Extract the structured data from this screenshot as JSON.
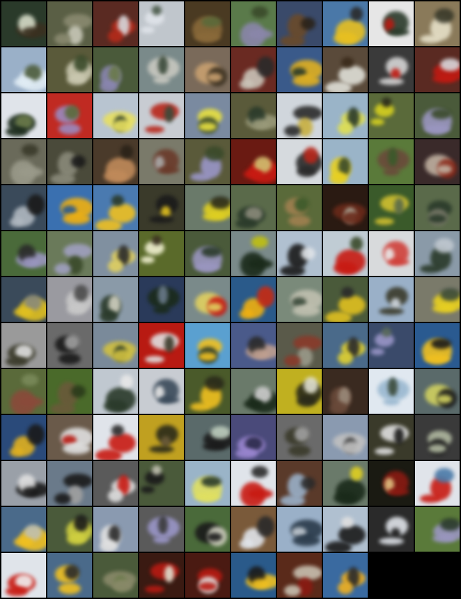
{
  "grid": {
    "rows": 13,
    "cols": 10,
    "tile_count": 128,
    "background": "#000000",
    "tiles": [
      [
        "#2a3a2a",
        "#3a3020",
        "#d6dcc8"
      ],
      [
        "#5a5f45",
        "#8a8a70",
        "#c8c8b8"
      ],
      [
        "#5a2a22",
        "#b52a1a",
        "#d6d8dc"
      ],
      [
        "#c0c6cc",
        "#e0e4ea",
        "#4a5a4a"
      ],
      [
        "#4a3a22",
        "#8a6a3a",
        "#5a6a3a"
      ],
      [
        "#5a7a4a",
        "#8a86aa",
        "#3a4a2a"
      ],
      [
        "#3a4a6a",
        "#6a4a2a",
        "#2a2218"
      ],
      [
        "#4a78a8",
        "#e8c020",
        "#2a2a2a"
      ],
      [
        "#e6e6e6",
        "#2a3a2a",
        "#b81a12"
      ],
      [
        "#8a7a5a",
        "#e6e0c8",
        "#3a3a2a"
      ],
      [
        "#9ab0c8",
        "#e0ecf4",
        "#4a5a3a"
      ],
      [
        "#5a5a3a",
        "#cac8b0",
        "#3a4a2a"
      ],
      [
        "#4a5a3a",
        "#8a86b0",
        "#6a7a4a"
      ],
      [
        "#7a8a8a",
        "#c8c8c0",
        "#3a4a3a"
      ],
      [
        "#7a6a5a",
        "#c8a070",
        "#3a3020"
      ],
      [
        "#6a2a22",
        "#cac4b8",
        "#2a2a2a"
      ],
      [
        "#3a5a8a",
        "#e0b020",
        "#2a3a2a"
      ],
      [
        "#5a4a3a",
        "#e0e0d8",
        "#3a2a1a"
      ],
      [
        "#3a3a3a",
        "#d6d6d6",
        "#c01a12"
      ],
      [
        "#5a2a22",
        "#c01a12",
        "#d6d8dc"
      ],
      [
        "#e0e4ea",
        "#1a2a1a",
        "#6a7a4a"
      ],
      [
        "#c02a22",
        "#9a8ac0",
        "#5a6a3a"
      ],
      [
        "#b8c4d0",
        "#e8e060",
        "#2a3a2a"
      ],
      [
        "#c8ccd2",
        "#b8261a",
        "#3a4a3a"
      ],
      [
        "#7a8aa0",
        "#e8e040",
        "#3a4a2a"
      ],
      [
        "#5a5a3a",
        "#9a9a7a",
        "#2a3a2a"
      ],
      [
        "#d0d6dc",
        "#2a2a2a",
        "#c8b040"
      ],
      [
        "#9ab4c8",
        "#e0e050",
        "#2a3a2a"
      ],
      [
        "#5a6a3a",
        "#d6d020",
        "#2a2a1a"
      ],
      [
        "#4a5a3a",
        "#9a96c0",
        "#3a4a2a"
      ],
      [
        "#6a6a5a",
        "#9a9a8a",
        "#3a3a2a"
      ],
      [
        "#4a4a3a",
        "#8a8a7a",
        "#1a1a1a"
      ],
      [
        "#4a3a2a",
        "#c08a5a",
        "#2a2218"
      ],
      [
        "#7a7a6a",
        "#6a3a2a",
        "#aaa"
      ],
      [
        "#5a5a3a",
        "#9a96c8",
        "#3a4a2a"
      ],
      [
        "#6a1a12",
        "#c81a12",
        "#d0c070"
      ],
      [
        "#d6dade",
        "#2a2a2a",
        "#b8261a"
      ],
      [
        "#9ab4c8",
        "#e8d020",
        "#3a4a2a"
      ],
      [
        "#5a7a3a",
        "#6a4a3a",
        "#3a5a2a"
      ],
      [
        "#3a2a2a",
        "#c0b0a0",
        "#8a2a1a"
      ],
      [
        "#3a4a5a",
        "#b0b8c0",
        "#1a1a1a"
      ],
      [
        "#3a70b0",
        "#f0b010",
        "#2a5a90"
      ],
      [
        "#4a7ab0",
        "#f0c020",
        "#2a3a2a"
      ],
      [
        "#3a3a2a",
        "#1a1a1a",
        "#e0c020"
      ],
      [
        "#6a7a6a",
        "#e0d020",
        "#2a2a1a"
      ],
      [
        "#5a6a4a",
        "#2a3a2a",
        "#8a8a7a"
      ],
      [
        "#5a6a3a",
        "#a08050",
        "#3a5a2a"
      ],
      [
        "#2a1a12",
        "#6a2a1a",
        "#b0b0a0"
      ],
      [
        "#3a5a2a",
        "#d0c030",
        "#5a6a4a"
      ],
      [
        "#5a6a4a",
        "#2a3a2a",
        "#7a7a6a"
      ],
      [
        "#4a6a3a",
        "#9a96c0",
        "#2a2a2a"
      ],
      [
        "#6a7a5a",
        "#a0a0c0",
        "#3a4a2a"
      ],
      [
        "#8090a0",
        "#e0d060",
        "#2a2a2a"
      ],
      [
        "#5a6a2a",
        "#f0f0d0",
        "#3a3020"
      ],
      [
        "#4a5a3a",
        "#9a96c0",
        "#2a3a2a"
      ],
      [
        "#7a8a8a",
        "#1a2a1a",
        "#c0c010"
      ],
      [
        "#b0c0d0",
        "#1a1a1a",
        "#e0e4e8"
      ],
      [
        "#c0ccd4",
        "#c81a12",
        "#3a4a2a"
      ],
      [
        "#d8dadc",
        "#d0403a",
        "#eaeaea"
      ],
      [
        "#8a9aa8",
        "#2a3a2a",
        "#c0c8d0"
      ],
      [
        "#3a4a5a",
        "#e0c020",
        "#8a8a7a"
      ],
      [
        "#9a9aa0",
        "#c8c8c8",
        "#4a4a4a"
      ],
      [
        "#8a9aa8",
        "#2a3a2a",
        "#d0d0c0"
      ],
      [
        "#2a3a5a",
        "#1a2a1a",
        "#6a7a8a"
      ],
      [
        "#7a8a8a",
        "#e0d060",
        "#c81a12"
      ],
      [
        "#2a5a8a",
        "#f0b010",
        "#c82a12"
      ],
      [
        "#7a8a7a",
        "#c0c0b0",
        "#3a4a3a"
      ],
      [
        "#4a5a3a",
        "#e0c020",
        "#2a2a2a"
      ],
      [
        "#9ab0c8",
        "#3a3a2a",
        "#d0d8e0"
      ],
      [
        "#7a7a6a",
        "#e8d020",
        "#3a4a3a"
      ],
      [
        "#9a9a9a",
        "#3a3a2a",
        "#e0e0e0"
      ],
      [
        "#6a6a6a",
        "#1a1a1a",
        "#a0a0a0"
      ],
      [
        "#7a8a9a",
        "#d0c040",
        "#2a3a2a"
      ],
      [
        "#b81a12",
        "#e0e0e0",
        "#3a3a2a"
      ],
      [
        "#5aa0d0",
        "#f0c020",
        "#2a3a2a"
      ],
      [
        "#4a5a8a",
        "#c0a090",
        "#2a2a2a"
      ],
      [
        "#5a5a4a",
        "#8a3a2a",
        "#9a9a8a"
      ],
      [
        "#4a6a8a",
        "#e0d030",
        "#2a2a2a"
      ],
      [
        "#3a4a6a",
        "#9a96c8",
        "#5a6a5a"
      ],
      [
        "#2a5a90",
        "#f0c020",
        "#1a1a1a"
      ],
      [
        "#5a6a3a",
        "#8a4a3a",
        "#7a8a5a"
      ],
      [
        "#4a6a2a",
        "#6a5a3a",
        "#2a3a1a"
      ],
      [
        "#c0c8d0",
        "#2a3a2a",
        "#e8e8e8"
      ],
      [
        "#c8ccd2",
        "#3a4a5a",
        "#e6e6e6"
      ],
      [
        "#4a5a2a",
        "#f0c020",
        "#2a2a1a"
      ],
      [
        "#6a7a6a",
        "#1a2a1a",
        "#d0d0d0"
      ],
      [
        "#c0b020",
        "#2a2a1a",
        "#e0e0d0"
      ],
      [
        "#3a2a20",
        "#6a4a3a",
        "#9a8a7a"
      ],
      [
        "#e0e8f0",
        "#9ab8d0",
        "#3a4a3a"
      ],
      [
        "#5a6a6a",
        "#d0d060",
        "#1a1a1a"
      ],
      [
        "#2a4a7a",
        "#e0b020",
        "#1a1a1a"
      ],
      [
        "#6a5a4a",
        "#e0e0e0",
        "#b81a12"
      ],
      [
        "#e0e4ea",
        "#c81a12",
        "#2a2a2a"
      ],
      [
        "#c0a020",
        "#2a2a1a",
        "#6a5a3a"
      ],
      [
        "#5a6a6a",
        "#1a1a1a",
        "#c0d0c0"
      ],
      [
        "#4a4a7a",
        "#9a86d0",
        "#2a2a4a"
      ],
      [
        "#6a6a6a",
        "#3a3a2a",
        "#a0a0a0"
      ],
      [
        "#8a9ab0",
        "#c0c0c0",
        "#3a3a3a"
      ],
      [
        "#3a3a2a",
        "#e0e0e0",
        "#1a1a1a"
      ],
      [
        "#3a3a3a",
        "#b0b8a0",
        "#1a1a1a"
      ],
      [
        "#9aa0a8",
        "#1a1a1a",
        "#e0e0e0"
      ],
      [
        "#6a7a8a",
        "#1a1a1a",
        "#a0a0a0"
      ],
      [
        "#5a5a5a",
        "#e0e0e0",
        "#c81a12"
      ],
      [
        "#4a5a3a",
        "#1a1a1a",
        "#c0c0b0"
      ],
      [
        "#9ab4c8",
        "#e0e060",
        "#2a3a2a"
      ],
      [
        "#e0e4ea",
        "#c81a12",
        "#2a2a2a"
      ],
      [
        "#5a3a2a",
        "#9ab0c8",
        "#2a2a2a"
      ],
      [
        "#6a7a6a",
        "#1a2a1a",
        "#e0d020"
      ],
      [
        "#1a1a12",
        "#8a1a12",
        "#e0c080"
      ],
      [
        "#e0e4ea",
        "#c81a12",
        "#4a7aa8"
      ],
      [
        "#4a6a8a",
        "#f0c020",
        "#c0c0b0"
      ],
      [
        "#4a5a3a",
        "#d0d040",
        "#1a1a1a"
      ],
      [
        "#8a9ab0",
        "#e0e0e0",
        "#2a2a2a"
      ],
      [
        "#5a5a5a",
        "#9a96c8",
        "#3a3a3a"
      ],
      [
        "#4a6a3a",
        "#1a1a1a",
        "#d0d0c0"
      ],
      [
        "#7a5a3a",
        "#e0e4ea",
        "#2a2a2a"
      ],
      [
        "#9ab0c8",
        "#2a3a4a",
        "#c0c8d0"
      ],
      [
        "#b0c0d0",
        "#1a1a1a",
        "#e0e0e0"
      ],
      [
        "#2a2a2a",
        "#e0e4ea",
        "#1a1a1a"
      ],
      [
        "#5a7a3a",
        "#9a96c0",
        "#2a3a2a"
      ],
      [
        "#e0e4ea",
        "#c81a12",
        "#f0f0f0"
      ],
      [
        "#4a6a8a",
        "#f0c020",
        "#2a2a2a"
      ],
      [
        "#4a5a3a",
        "#8a8a6a",
        "#6a7a4a"
      ],
      [
        "#3a1a12",
        "#b81a12",
        "#e0e0d0"
      ],
      [
        "#4a1a12",
        "#b81a12",
        "#e0e0e0"
      ],
      [
        "#2a5a8a",
        "#f0c020",
        "#1a1a1a"
      ],
      [
        "#5a2a1a",
        "#c8c0b0",
        "#8a1a12"
      ],
      [
        "#3a6aa0",
        "#f0b020",
        "#2a2a2a"
      ]
    ]
  }
}
